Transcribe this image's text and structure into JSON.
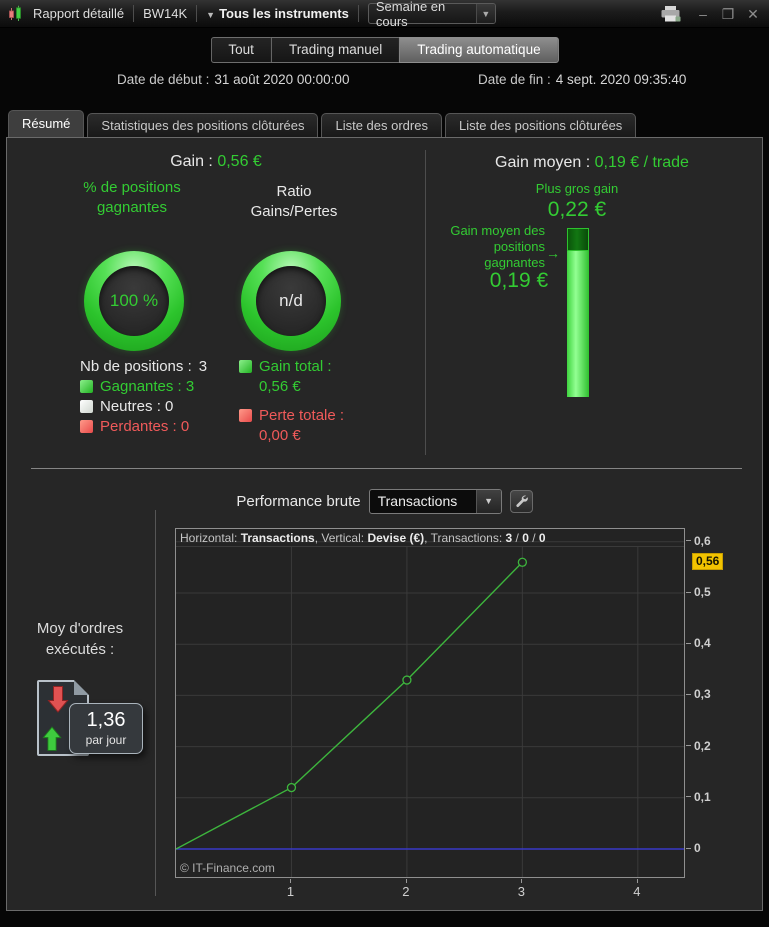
{
  "titlebar": {
    "title": "Rapport détaillé",
    "code": "BW14K",
    "instruments_menu": "Tous les instruments",
    "period_select": "Semaine en cours",
    "window": {
      "minimize": "–",
      "maximize": "❐",
      "close": "✕"
    }
  },
  "toolbar": {
    "filters": [
      {
        "label": "Tout",
        "active": false
      },
      {
        "label": "Trading manuel",
        "active": false
      },
      {
        "label": "Trading automatique",
        "active": true
      }
    ],
    "date_start_label": "Date de début :",
    "date_start_value": "31 août 2020 00:00:00",
    "date_end_label": "Date de fin :",
    "date_end_value": "4 sept. 2020 09:35:40"
  },
  "tabs": [
    {
      "label": "Résumé",
      "active": true
    },
    {
      "label": "Statistiques des positions clôturées",
      "active": false
    },
    {
      "label": "Liste des ordres",
      "active": false
    },
    {
      "label": "Liste des positions clôturées",
      "active": false
    }
  ],
  "summary": {
    "gain_label": "Gain :",
    "gain_value": "0,56 €",
    "win_pct_label": "% de positions gagnantes",
    "win_pct_value": "100 %",
    "ratio_label": "Ratio Gains/Pertes",
    "ratio_value": "n/d",
    "positions_count_label": "Nb de positions :",
    "positions_count_value": "3",
    "position_rows": [
      {
        "label": "Gagnantes :",
        "value": "3",
        "color": "#33cc33"
      },
      {
        "label": "Neutres :",
        "value": "0",
        "color": "#e8e8e8"
      },
      {
        "label": "Perdantes :",
        "value": "0",
        "color": "#f05a5a"
      }
    ],
    "totals": [
      {
        "label": "Gain total :",
        "value": "0,56 €",
        "color": "#33cc33"
      },
      {
        "label": "Perte totale :",
        "value": "0,00 €",
        "color": "#f05a5a"
      }
    ]
  },
  "avg_panel": {
    "title_label": "Gain moyen :",
    "title_value": "0,19 € / trade",
    "biggest_label": "Plus gros gain",
    "biggest_value": "0,22 €",
    "avg_win_label": "Gain moyen des positions gagnantes",
    "avg_win_arrow": "→",
    "avg_win_value": "0,19 €",
    "bar": {
      "max": 0.22,
      "value": 0.19
    }
  },
  "performance": {
    "title": "Performance brute",
    "selector_value": "Transactions"
  },
  "orders_avg": {
    "label": "Moy d'ordres exécutés :",
    "value": "1,36",
    "unit": "par jour"
  },
  "chart_data": {
    "type": "line",
    "title": "Performance brute",
    "header": {
      "h_label": "Horizontal: ",
      "h_value": "Transactions",
      "sep1": ", ",
      "v_label": "Vertical: ",
      "v_value": "Devise (€)",
      "sep2": ", ",
      "t_label": "Transactions: ",
      "wins": "3",
      "slash1": " / ",
      "neutrals": "0",
      "slash2": " / ",
      "losses": "0"
    },
    "xlabel": "Transactions",
    "ylabel": "Devise (€)",
    "x": [
      0,
      1,
      2,
      3
    ],
    "y": [
      0,
      0.12,
      0.33,
      0.56
    ],
    "marker_from_index": 1,
    "xlim": [
      0,
      4.4
    ],
    "ylim": [
      0,
      0.625
    ],
    "x_ticks": [
      {
        "v": 1,
        "label": "1"
      },
      {
        "v": 2,
        "label": "2"
      },
      {
        "v": 3,
        "label": "3"
      },
      {
        "v": 4,
        "label": "4"
      }
    ],
    "y_ticks": [
      {
        "v": 0,
        "label": "0"
      },
      {
        "v": 0.1,
        "label": "0,1"
      },
      {
        "v": 0.2,
        "label": "0,2"
      },
      {
        "v": 0.3,
        "label": "0,3"
      },
      {
        "v": 0.4,
        "label": "0,4"
      },
      {
        "v": 0.5,
        "label": "0,5"
      },
      {
        "v": 0.6,
        "label": "0,6"
      }
    ],
    "badge": {
      "value": 0.56,
      "label": "0,56",
      "bg": "#f2c300"
    },
    "grid": true,
    "legend": "none",
    "line_color": "#3db53d",
    "zero_line_color": "#3939c8",
    "grid_color": "#3a3a3a",
    "watermark": "© IT-Finance.com"
  },
  "colors": {
    "green": "#33cc33",
    "red": "#f05a5a",
    "panel_bg": "#262626",
    "badge_yellow": "#f2c300"
  }
}
